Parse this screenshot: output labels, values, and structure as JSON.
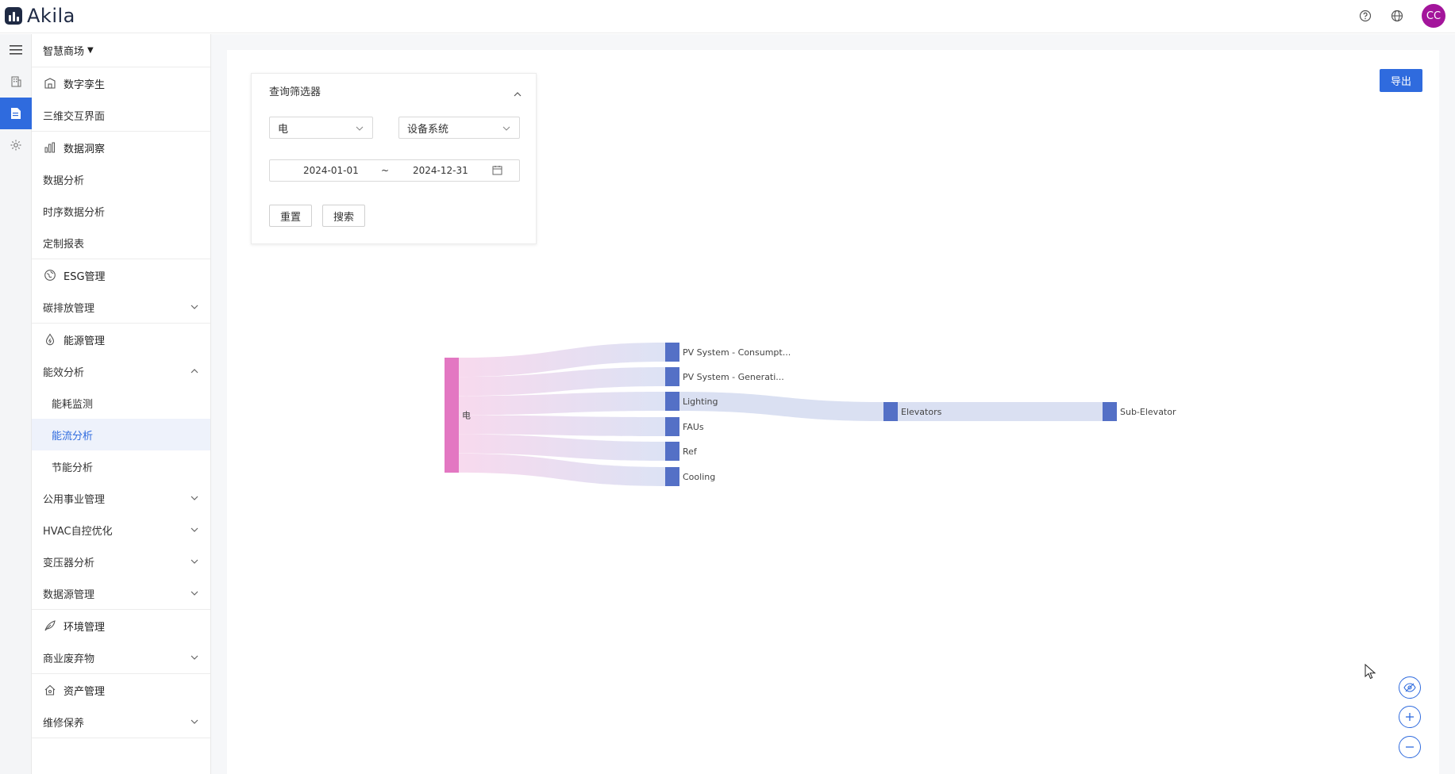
{
  "header": {
    "brand_name": "Akila",
    "avatar_initials": "CC"
  },
  "sidebar": {
    "site_selector": "智慧商场",
    "groups": [
      {
        "title": "数字孪生",
        "icon": "building-icon",
        "items": [
          {
            "label": "三维交互界面"
          }
        ]
      },
      {
        "title": "数据洞察",
        "icon": "bar-chart-icon",
        "items": [
          {
            "label": "数据分析"
          },
          {
            "label": "时序数据分析"
          },
          {
            "label": "定制报表"
          }
        ]
      },
      {
        "title": "ESG管理",
        "icon": "globe-leaf-icon",
        "items": [
          {
            "label": "碳排放管理",
            "expandable": true
          }
        ]
      },
      {
        "title": "能源管理",
        "icon": "energy-drop-icon",
        "items": [
          {
            "label": "能效分析",
            "expanded": true
          },
          {
            "label": "能耗监测",
            "sub": true
          },
          {
            "label": "能流分析",
            "sub": true,
            "selected": true
          },
          {
            "label": "节能分析",
            "sub": true
          },
          {
            "label": "公用事业管理",
            "expandable": true
          },
          {
            "label": "HVAC自控优化",
            "expandable": true
          },
          {
            "label": "变压器分析",
            "expandable": true
          },
          {
            "label": "数据源管理",
            "expandable": true
          }
        ]
      },
      {
        "title": "环境管理",
        "icon": "leaf-icon",
        "items": [
          {
            "label": "商业废弃物",
            "expandable": true
          }
        ]
      },
      {
        "title": "资产管理",
        "icon": "house-icon",
        "items": [
          {
            "label": "维修保养",
            "expandable": true
          }
        ]
      }
    ]
  },
  "filter": {
    "title": "查询筛选器",
    "energy_type": "电",
    "grouping": "设备系统",
    "date_start": "2024-01-01",
    "date_separator": "~",
    "date_end": "2024-12-31",
    "reset_label": "重置",
    "search_label": "搜索"
  },
  "toolbar": {
    "export_label": "导出"
  },
  "chart_data": {
    "type": "sankey",
    "nodes": [
      {
        "name": "电",
        "color": "#e377c2"
      },
      {
        "name": "PV System - Consumpt...",
        "color": "#5470c6"
      },
      {
        "name": "PV System - Generati...",
        "color": "#5470c6"
      },
      {
        "name": "Lighting",
        "color": "#5470c6"
      },
      {
        "name": "FAUs",
        "color": "#5470c6"
      },
      {
        "name": "Ref",
        "color": "#5470c6"
      },
      {
        "name": "Cooling",
        "color": "#5470c6"
      },
      {
        "name": "Elevators",
        "color": "#5470c6"
      },
      {
        "name": "Sub-Elevator",
        "color": "#5470c6"
      }
    ],
    "links": [
      {
        "source": "电",
        "target": "PV System - Consumpt...",
        "value": 1
      },
      {
        "source": "电",
        "target": "PV System - Generati...",
        "value": 1
      },
      {
        "source": "电",
        "target": "Lighting",
        "value": 1
      },
      {
        "source": "电",
        "target": "FAUs",
        "value": 1
      },
      {
        "source": "电",
        "target": "Ref",
        "value": 1
      },
      {
        "source": "电",
        "target": "Cooling",
        "value": 1
      },
      {
        "source": "Lighting",
        "target": "Elevators",
        "value": 1
      },
      {
        "source": "Elevators",
        "target": "Sub-Elevator",
        "value": 1
      }
    ]
  }
}
